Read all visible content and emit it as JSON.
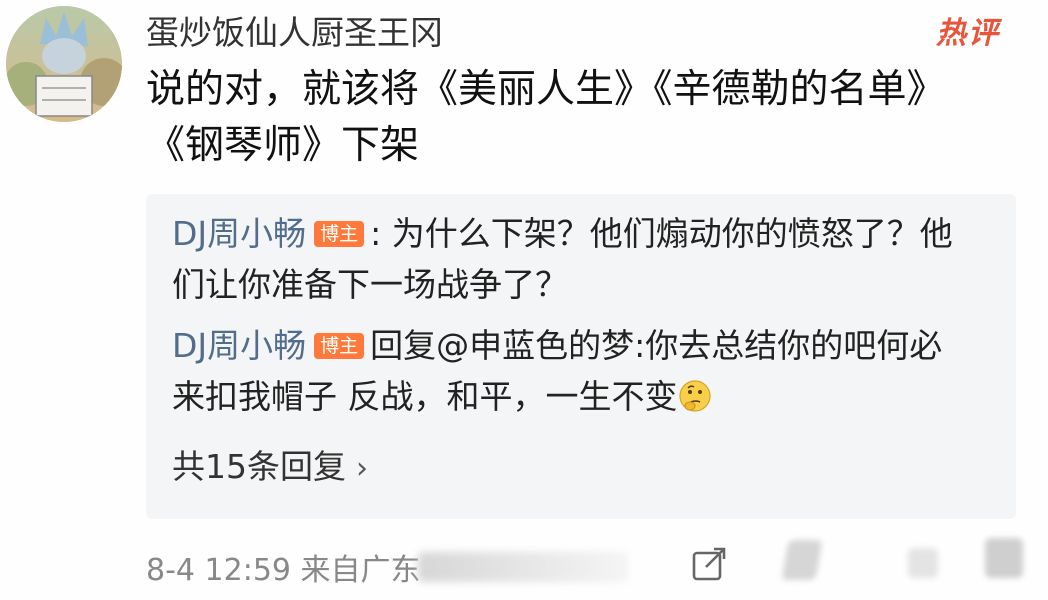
{
  "header": {
    "username": "蛋炒饭仙人厨圣王冈",
    "badge": "热评"
  },
  "comment": {
    "text": "说的对，就该将《美丽人生》《辛德勒的名单》《钢琴师》下架"
  },
  "replies": [
    {
      "name": "DJ周小畅",
      "tag": "博主",
      "text": ": 为什么下架？他们煽动你的愤怒了？他们让你准备下一场战争了？"
    },
    {
      "name": "DJ周小畅",
      "tag": "博主",
      "text": "回复@申蓝色的梦:你去总结你的吧何必来扣我帽子 反战，和平，一生不变"
    }
  ],
  "view_replies": {
    "label": "共15条回复",
    "chevron": "›"
  },
  "footer": {
    "meta": "8-4 12:59  来自广东"
  },
  "icons": {
    "share": "share-icon",
    "emoji": "thinking-face-icon"
  },
  "colors": {
    "hot": "#e8553b",
    "blogger_badge": "#ff7a3a",
    "reply_name": "#526c8c",
    "reply_bg": "#f4f5f6"
  }
}
